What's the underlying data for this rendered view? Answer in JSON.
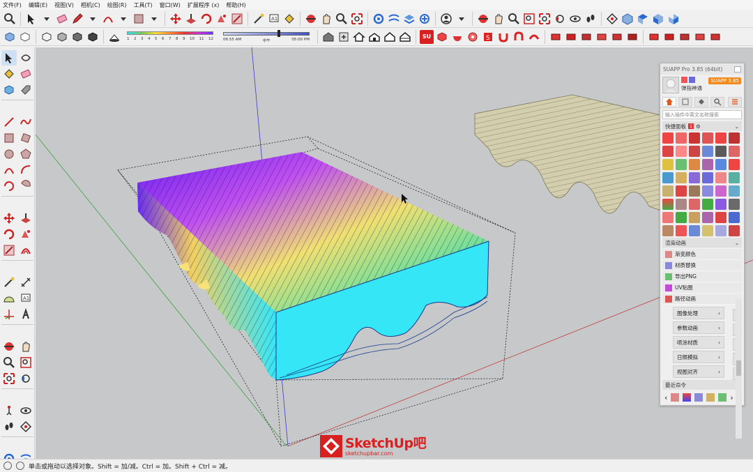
{
  "menu": {
    "items": [
      "文件(F)",
      "编辑(E)",
      "视图(V)",
      "相机(C)",
      "绘图(R)",
      "工具(T)",
      "窗口(W)",
      "扩展程序 (x)",
      "帮助(H)"
    ]
  },
  "toolbar": {
    "gradient_numbers": [
      "1",
      "2",
      "3",
      "4",
      "5",
      "6",
      "7",
      "8",
      "9",
      "10",
      "11",
      "12"
    ],
    "shadow_time_start": "06:55 AM",
    "shadow_time_mid": "中午",
    "shadow_time_end": "05:00 PM",
    "su_badge": "SU"
  },
  "panel": {
    "title": "SUAPP Pro 3.85 (64bit)",
    "user_name": "弹指神通",
    "version_badge": "SUAPP 3.85",
    "search_placeholder": "输入插件中英文名称搜索",
    "quick_panel_label": "快捷面板",
    "quick_panel_badge": "1",
    "render_anim_label": "渲染动画",
    "anim_items": [
      "渐变颜色",
      "材质替换",
      "导出PNG",
      "UV贴图",
      "路径动画"
    ],
    "sub_buttons": [
      "图像处理",
      "参数动画",
      "喷涂材质",
      "日照模拟",
      "视图对齐"
    ],
    "recent_label": "最近命令"
  },
  "status": {
    "message": "单击或拖动以选择对象。Shift = 加/减。Ctrl = 加。Shift + Ctrl = 减。"
  },
  "watermark": {
    "title": "SketchUp吧",
    "url": "sketchupbar.com"
  },
  "colors": {
    "viewport_bg": "#c6c8ca",
    "slab_cyan": "#35e6f6",
    "slab_purple": "#7a2cf0",
    "axis_blue": "#3a3ad0",
    "axis_red": "#c04040",
    "axis_green": "#40a040",
    "suapp_orange": "#f38a1a",
    "brand_red": "#d82020"
  }
}
